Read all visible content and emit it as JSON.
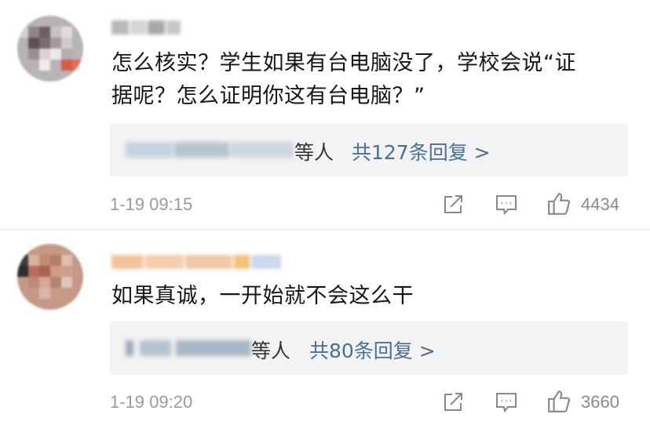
{
  "comments": [
    {
      "text_line1": "怎么核实？学生如果有台电脑没了，学校会说“证",
      "text_line2": "据呢？怎么证明你这有台电脑？”",
      "replies_suffix": "等人",
      "replies_link": "共127条回复 >",
      "timestamp": "1-19 09:15",
      "likes": "4434"
    },
    {
      "text_line1": "如果真诚，一开始就不会这么干",
      "replies_suffix": "等人",
      "replies_link": "共80条回复 >",
      "timestamp": "1-19 09:20",
      "likes": "3660"
    }
  ],
  "icons": {
    "share": "share-icon",
    "comment": "comment-icon",
    "like": "thumbs-up-icon"
  },
  "colors": {
    "link": "#4a6f95",
    "timestamp": "#9a9a9a",
    "reply_box": "#f3f3f3"
  }
}
